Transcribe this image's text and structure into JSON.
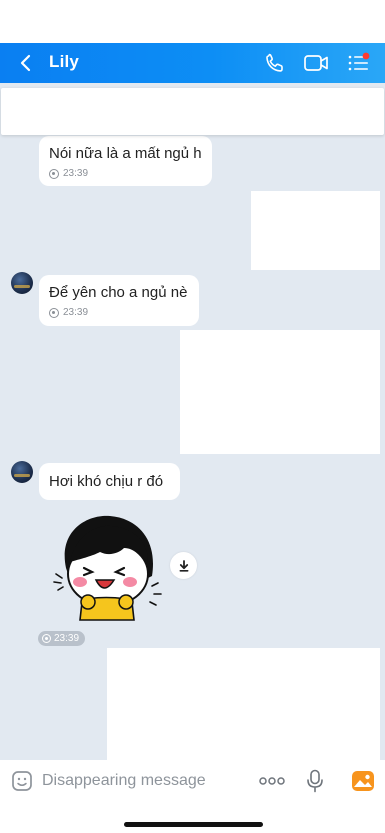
{
  "header": {
    "contact_name": "Lily",
    "icons": [
      "back-icon",
      "phone-icon",
      "video-call-icon",
      "menu-list-icon"
    ],
    "colors": {
      "header_start": "#0a7ff2",
      "header_end": "#2aa7f7",
      "notification_dot": "#ff3b30"
    }
  },
  "messages": [
    {
      "sender": "Lily",
      "text": "Nói nữa là a mất ngủ h",
      "time": "23:39"
    },
    {
      "sender": "Lily",
      "text": "Để yên cho a ngủ nè",
      "time": "23:39"
    },
    {
      "sender": "Lily",
      "text": "Hơi khó chịu r đó",
      "time": ""
    },
    {
      "sender": "Lily",
      "type": "sticker",
      "time": "23:39"
    }
  ],
  "input": {
    "placeholder": "Disappearing message"
  },
  "colors": {
    "chat_background": "#e2e9f1",
    "accent": "#0d8ef5",
    "image_icon": "#f7941d"
  }
}
